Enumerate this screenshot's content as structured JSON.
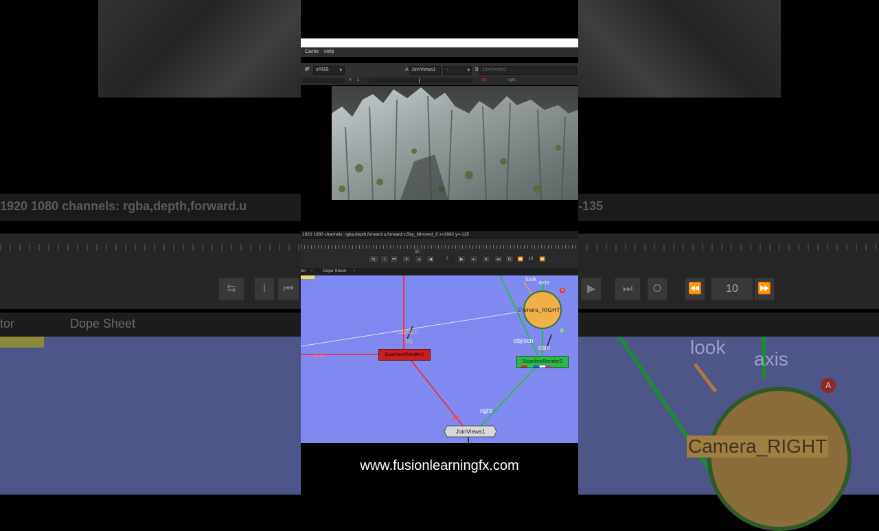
{
  "menu": {
    "items": [
      "Cache",
      "Help"
    ]
  },
  "viewer": {
    "ip_label": "IP",
    "colorspace": "sRGB",
    "input_a_label": "A",
    "input_a": "JoinViews1",
    "input_a_dash": "-",
    "input_b_label": "B",
    "input_b": "JoinViews1",
    "y_label": "Y",
    "y_value": "1",
    "view_left": "left",
    "view_right": "right",
    "info_line": "1920 1080 channels: rgba,depth,forward.u,forward.v,Sky_Mirrored_0  x=2682 y=-135",
    "info_line_bg": "1920 1080 channels: rgba,depth,forward.u",
    "info_line_bg_right": "-135"
  },
  "timeline": {
    "tick_label": "50",
    "current_frame": "2",
    "increment": "10",
    "increment_bg": "10"
  },
  "tabs": {
    "node_graph_partial": "tor",
    "dope_sheet": "Dope Sheet",
    "node_graph_partial_bg": "tor"
  },
  "graph": {
    "nodes": {
      "camera": "Camera_RIGHT",
      "scanline_left": "ScanlineRender1",
      "scanline_right": "ScanlineRender2",
      "join": "JoinViews1"
    },
    "labels": {
      "look": "look",
      "axis": "axis",
      "obj_scn_left": "obj/scn",
      "bg": "bg",
      "cam_left": "cam",
      "obj_scn_right": "obj/scn",
      "cam_right": "cam",
      "left": "left",
      "right": "right",
      "badge": "A"
    },
    "colors": {
      "background": "#8089ef",
      "left_pipe": "#ff1e1e",
      "right_pipe": "#1fbf4a",
      "camera_node": "#f2b04a"
    }
  },
  "footer": {
    "url": "www.fusionlearningfx.com"
  }
}
